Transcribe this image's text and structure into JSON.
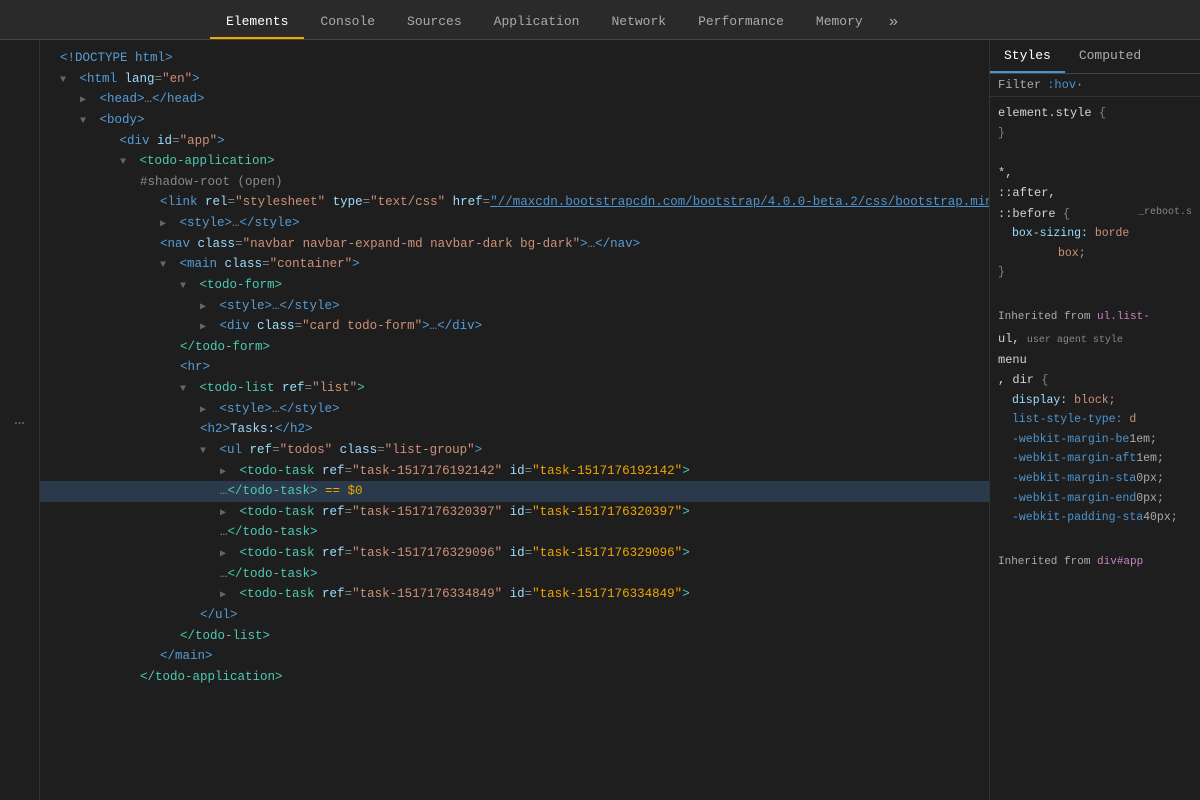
{
  "tabs": {
    "list": [
      "Elements",
      "Console",
      "Sources",
      "Application",
      "Network",
      "Performance",
      "Memory"
    ],
    "active": "Elements",
    "more_icon": "»"
  },
  "sidebar": {
    "collapsed_label": "…"
  },
  "dom": {
    "lines": [
      {
        "indent": 0,
        "content": "doctype",
        "text": "<!DOCTYPE html>",
        "class": "tag"
      },
      {
        "indent": 0,
        "content": "html_open",
        "text": "<html lang=\"en\">"
      },
      {
        "indent": 1,
        "content": "head",
        "text": "▶<head>…</head>"
      },
      {
        "indent": 1,
        "content": "body",
        "text": "▼<body>"
      },
      {
        "indent": 2,
        "content": "div_app",
        "text": "<div id=\"app\">"
      },
      {
        "indent": 3,
        "content": "todo_app",
        "text": "▼<todo-application>"
      },
      {
        "indent": 4,
        "content": "shadow_root",
        "text": "#shadow-root (open)"
      },
      {
        "indent": 5,
        "content": "link",
        "text": "<link rel=\"stylesheet\" type=\"text/css\" href=\"//maxcdn.bootstrapcdn.com/bootstrap/4.0.0-beta.2/css/bootstrap.min.css\">"
      },
      {
        "indent": 5,
        "content": "style1",
        "text": "▶<style>…</style>"
      },
      {
        "indent": 5,
        "content": "nav",
        "text": "<nav class=\"navbar navbar-expand-md navbar-dark bg-dark\">…</nav>"
      },
      {
        "indent": 5,
        "content": "main_open",
        "text": "▼<main class=\"container\">"
      },
      {
        "indent": 6,
        "content": "todo_form",
        "text": "▼<todo-form>"
      },
      {
        "indent": 7,
        "content": "style2",
        "text": "▶<style>…</style>"
      },
      {
        "indent": 7,
        "content": "div_card",
        "text": "▶<div class=\"card todo-form\">…</div>"
      },
      {
        "indent": 6,
        "content": "todo_form_close",
        "text": "</todo-form>"
      },
      {
        "indent": 6,
        "content": "hr",
        "text": "<hr>"
      },
      {
        "indent": 6,
        "content": "todo_list_open",
        "text": "▼<todo-list ref=\"list\">"
      },
      {
        "indent": 7,
        "content": "style3",
        "text": "▶<style>…</style>"
      },
      {
        "indent": 7,
        "content": "h2",
        "text": "<h2>Tasks:</h2>"
      },
      {
        "indent": 7,
        "content": "ul_open",
        "text": "▼<ul ref=\"todos\" class=\"list-group\">"
      },
      {
        "indent": 8,
        "content": "task1_open",
        "text": "▶<todo-task ref=\"task-1517176192142\" id=\"task-1517176192142\">"
      },
      {
        "indent": 8,
        "content": "task1_close_eq",
        "text": "…</todo-task> == $0"
      },
      {
        "indent": 8,
        "content": "task2_open",
        "text": "▶<todo-task ref=\"task-1517176320397\" id=\"task-1517176320397\">"
      },
      {
        "indent": 8,
        "content": "task2_close",
        "text": "…</todo-task>"
      },
      {
        "indent": 8,
        "content": "task3_open",
        "text": "▶<todo-task ref=\"task-1517176329096\" id=\"task-1517176329096\">"
      },
      {
        "indent": 8,
        "content": "task3_close",
        "text": "…</todo-task>"
      },
      {
        "indent": 8,
        "content": "task4_open",
        "text": "▶<todo-task ref=\"task-1517176334849\" id=\"task-1517176334849\">"
      },
      {
        "indent": 7,
        "content": "ul_close",
        "text": "</ul>"
      },
      {
        "indent": 6,
        "content": "todo_list_close",
        "text": "</todo-list>"
      },
      {
        "indent": 5,
        "content": "main_close",
        "text": "</main>"
      },
      {
        "indent": 4,
        "content": "todo_app_close",
        "text": "</todo-application>"
      }
    ]
  },
  "styles": {
    "tabs": [
      "Styles",
      "Computed"
    ],
    "active_tab": "Styles",
    "filter_placeholder": "Filter",
    "filter_pseudo": ":hov",
    "filter_dot": "·",
    "sections": [
      {
        "selector": "element.style {",
        "close": "}",
        "properties": []
      },
      {
        "selector": "*,",
        "selector2": "::after,",
        "selector3": "::before {",
        "source": "_reboot.s",
        "properties": [
          {
            "prop": "box-sizing:",
            "val": "borde",
            "continued": true
          },
          {
            "prop": "",
            "val": "box;",
            "continued": false
          }
        ],
        "close": "}"
      },
      {
        "inherited_label": "Inherited from ul.list-",
        "inherited_lines": [
          "ul,  user agent style",
          "menu",
          ", dir {"
        ],
        "properties": [
          {
            "prop": "display:",
            "val": "block;",
            "webkit": false
          },
          {
            "prop": "list-style-type:",
            "val": "d",
            "webkit": false,
            "highlight": true
          },
          {
            "prop": "-webkit-margin-be",
            "val": "1em;",
            "webkit": true
          },
          {
            "prop": "-webkit-margin-aft",
            "val": "1em;",
            "webkit": true
          },
          {
            "prop": "-webkit-margin-sta",
            "val": "0px;",
            "webkit": true
          },
          {
            "prop": "-webkit-margin-end",
            "val": "0px;",
            "webkit": true
          },
          {
            "prop": "-webkit-padding-sta",
            "val": "40px;",
            "webkit": true
          }
        ]
      },
      {
        "inherited_label": "Inherited from div#app"
      }
    ]
  }
}
